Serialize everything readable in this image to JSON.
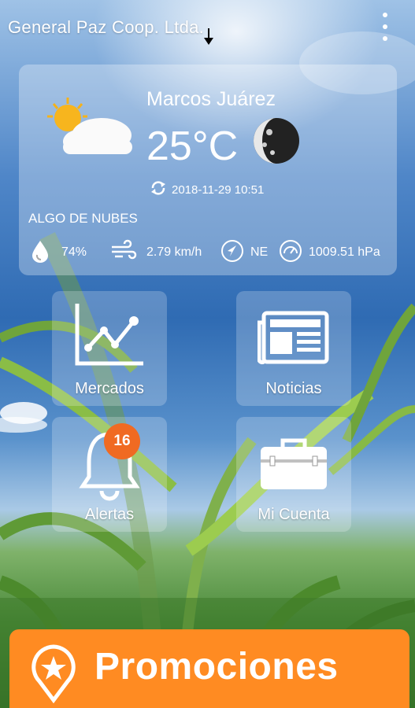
{
  "header": {
    "title": "General Paz Coop. Ltda."
  },
  "weather": {
    "city": "Marcos Juárez",
    "temperature": "25°C",
    "updated": "2018-11-29 10:51",
    "condition": "ALGO DE NUBES",
    "humidity": "74%",
    "wind_speed": "2.79 km/h",
    "wind_direction": "NE",
    "pressure": "1009.51 hPa"
  },
  "tiles": [
    {
      "label": "Mercados",
      "icon": "chart-icon"
    },
    {
      "label": "Noticias",
      "icon": "newspaper-icon"
    },
    {
      "label": "Alertas",
      "icon": "bell-icon",
      "badge": "16"
    },
    {
      "label": "Mi Cuenta",
      "icon": "briefcase-icon"
    }
  ],
  "promo": {
    "label": "Promociones"
  },
  "colors": {
    "accent": "#ff8b22",
    "badge": "#f06a22"
  }
}
